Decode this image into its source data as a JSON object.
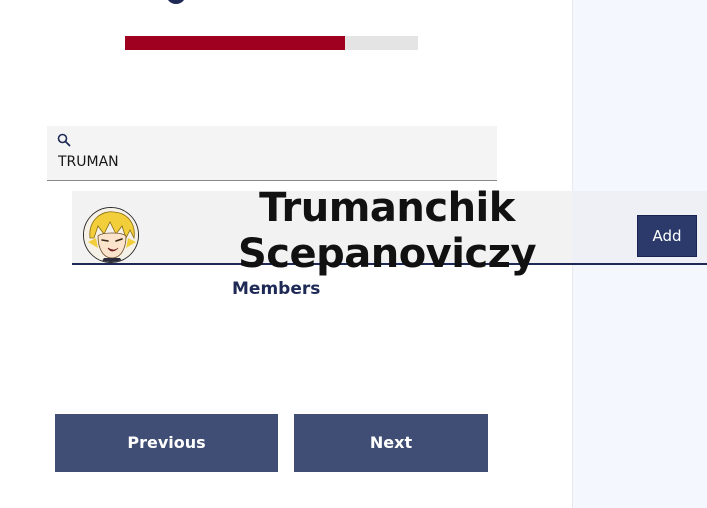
{
  "progress": {
    "percent": 75,
    "fill_color": "#a00020",
    "track_color": "#e4e4e4"
  },
  "search": {
    "icon": "search-icon",
    "value": "TRUMAN"
  },
  "results": [
    {
      "avatar": "avatar-anime-character",
      "name": "Trumanchik Scepanoviczy",
      "add_label": "Add"
    }
  ],
  "members": {
    "label": "Members"
  },
  "pagination": {
    "previous_label": "Previous",
    "next_label": "Next"
  },
  "colors": {
    "brand_dark": "#1e2a55",
    "button": "#404d74",
    "add_button": "#2b3a6b",
    "side_panel": "#f4f7fd"
  }
}
